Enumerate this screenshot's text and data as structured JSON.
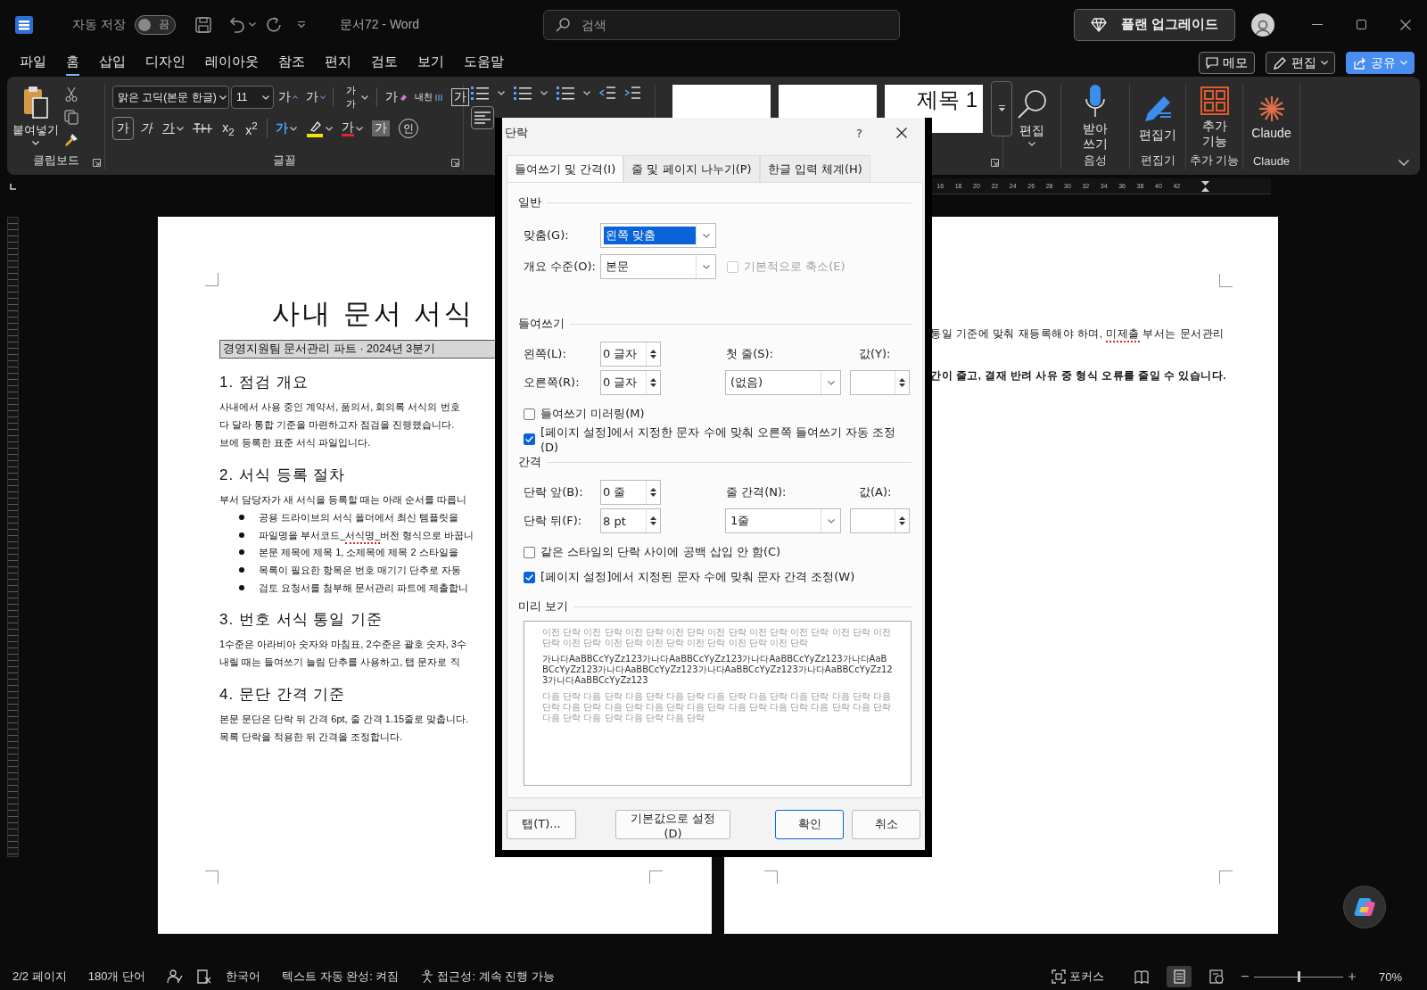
{
  "titlebar": {
    "autosave_label": "자동 저장",
    "autosave_toggle": {
      "label": "끔",
      "on": false
    },
    "document_title": "문서72  -  Word",
    "search": {
      "placeholder": "검색"
    },
    "upgrade_button": "플랜 업그레이드"
  },
  "menu": {
    "tabs": [
      {
        "label": "파일",
        "selected": false
      },
      {
        "label": "홈",
        "selected": true
      },
      {
        "label": "삽입",
        "selected": false
      },
      {
        "label": "디자인",
        "selected": false
      },
      {
        "label": "레이아웃",
        "selected": false
      },
      {
        "label": "참조",
        "selected": false
      },
      {
        "label": "편지",
        "selected": false
      },
      {
        "label": "검토",
        "selected": false
      },
      {
        "label": "보기",
        "selected": false
      },
      {
        "label": "도움말",
        "selected": false
      }
    ],
    "buttons": [
      {
        "kind": "comment",
        "label": "메모"
      },
      {
        "kind": "edit",
        "label": "편집"
      },
      {
        "kind": "share",
        "label": "공유"
      }
    ]
  },
  "ribbon": {
    "clipboard": {
      "paste": "붙여넣기",
      "label": "클립보드"
    },
    "font": {
      "typeface": "맑은 고딕(본문 한글)",
      "size": "11",
      "label": "글꼴",
      "row1": [
        {
          "kind": "grow",
          "text": "가",
          "menu": false
        },
        {
          "kind": "shrink",
          "text": "가",
          "menu": false
        },
        {
          "kind": "case",
          "text": "가가",
          "menu": true
        },
        {
          "kind": "clear",
          "text": "가",
          "menu": false
        },
        {
          "kind": "phonetic",
          "text": "내천",
          "menu": false
        },
        {
          "kind": "border",
          "text": "가",
          "menu": false
        }
      ],
      "row2": [
        {
          "kind": "bold",
          "text": "가",
          "pressed": true,
          "menu": false
        },
        {
          "kind": "italic",
          "text": "가",
          "pressed": false,
          "menu": false
        },
        {
          "kind": "underline",
          "text": "가",
          "pressed": false,
          "menu": true
        },
        {
          "kind": "strike",
          "pressed": false,
          "menu": false
        },
        {
          "kind": "subscript",
          "text": "x$_{2}$",
          "pressed": false,
          "menu": false
        },
        {
          "kind": "superscript",
          "text": "x$^{2}$",
          "pressed": false,
          "menu": false
        },
        {
          "kind": "effects",
          "text": "가",
          "pressed": false,
          "menu": true
        },
        {
          "kind": "highlight",
          "pressed": false,
          "menu": true
        },
        {
          "kind": "color",
          "text": "가",
          "pressed": false,
          "menu": true
        },
        {
          "kind": "shading",
          "text": "가",
          "pressed": false,
          "menu": false
        },
        {
          "kind": "enclose",
          "text": "인",
          "pressed": false,
          "menu": false
        }
      ]
    },
    "styles": {
      "items": [
        {
          "label": "제목 1"
        }
      ]
    },
    "groups": [
      {
        "kind": "search",
        "button": "편집"
      },
      {
        "kind": "mic",
        "button": "받아\n쓰기",
        "label": "음성"
      },
      {
        "kind": "editor",
        "button": "편집기",
        "label": "편집기"
      },
      {
        "kind": "addins",
        "button": "추가\n기능",
        "label": "추가 기능"
      },
      {
        "kind": "claude",
        "button": "Claude",
        "label": "Claude"
      }
    ]
  },
  "ruler_numbers": [
    "16",
    "18",
    "20",
    "22",
    "24",
    "26",
    "28",
    "30",
    "32",
    "34",
    "36",
    "38",
    "40",
    "42"
  ],
  "left_page": {
    "title": "사내 문서 서식",
    "subtitle": "경영지원팀 문서관리 파트 · 2024년 3분기",
    "sections": [
      {
        "heading": "1. 점검 개요",
        "lines": [
          "사내에서 사용 중인 계약서, 품의서, 회의록 서식의 번호",
          "다 달라 통합 기준을 마련하고자 점검을 진행했습니다.",
          "브에 등록한 표준 서식 파일입니다."
        ]
      },
      {
        "heading": "2. 서식 등록 절차",
        "lines": [
          "부서 담당자가 새 서식을 등록할 때는 아래 순서를 따릅니"
        ],
        "bullets": [
          "공용 드라이브의 서식 폴더에서 최신 템플릿을",
          {
            "parts": [
              {
                "text": "파일명을 부서코드_",
                "misspelled": false
              },
              {
                "text": "서식명_",
                "misspelled": true
              },
              {
                "text": "버전 형식으로 바꿉니",
                "misspelled": false
              }
            ]
          },
          "본문 제목에 제목 1, 소제목에 제목 2 스타일을",
          "목록이 필요한 항목은 번호 매기기 단추로 자동",
          "검토 요청서를 첨부해 문서관리 파트에 제출합니"
        ]
      },
      {
        "heading": "3. 번호 서식 통일 기준",
        "lines": [
          "1수준은 아라비아 숫자와 마침표, 2수준은 괄호 숫자, 3수",
          "내릴 때는 들여쓰기 늘림 단추를 사용하고, 탭 문자로 직"
        ]
      },
      {
        "heading": "4. 문단 간격 기준",
        "lines": [
          "본문 문단은 단락 뒤 간격 6pt, 줄 간격 1.15줄로 맞춥니다.",
          "목록 단락을 적용한 뒤 간격을 조정합니다."
        ]
      }
    ]
  },
  "right_page": {
    "lines": [
      {
        "bold": false,
        "parts": [
          {
            "text": "통일 기준에 맞춰 재등록해야 하며, ",
            "misspelled": false
          },
          {
            "text": "미제출",
            "misspelled": true
          },
          {
            "text": " 부서는 문서관리",
            "misspelled": false
          }
        ]
      },
      {
        "bold": true,
        "parts": [
          {
            "text": "간이 줄고, 결재 반려 사유 중 형식 오류를 줄일 수 있습니다.",
            "misspelled": false
          }
        ]
      }
    ]
  },
  "dialog": {
    "title": "단락",
    "help": "?",
    "tabs": [
      {
        "label": "들여쓰기 및 간격(I)",
        "selected": true
      },
      {
        "label": "줄 및 페이지 나누기(P)",
        "selected": false
      },
      {
        "label": "한글 입력 체계(H)",
        "selected": false
      }
    ],
    "general": {
      "heading": "일반",
      "alignment": {
        "label": "맞춤(G):",
        "value": "왼쪽 맞춤",
        "focused": true
      },
      "outline": {
        "label": "개요 수준(O):",
        "value": "본문",
        "focused": false
      },
      "collapse": {
        "label": "기본적으로 축소(E)",
        "checked": false,
        "disabled": true
      }
    },
    "indent": {
      "heading": "들여쓰기",
      "left": {
        "label": "왼쪽(L):",
        "value": "0 글자"
      },
      "right": {
        "label": "오른쪽(R):",
        "value": "0 글자"
      },
      "special": {
        "label": "첫 줄(S):",
        "value": "(없음)"
      },
      "by": {
        "label": "값(Y):"
      },
      "options": [
        {
          "label": "들여쓰기 미러링(M)",
          "checked": false
        },
        {
          "label": "[페이지 설정]에서 지정한 문자 수에 맞춰 오른쪽 들여쓰기 자동 조정(D)",
          "checked": true
        }
      ]
    },
    "spacing": {
      "heading": "간격",
      "before": {
        "label": "단락 앞(B):",
        "value": "0 줄"
      },
      "after": {
        "label": "단락 뒤(F):",
        "value": "8 pt"
      },
      "line": {
        "label": "줄 간격(N):",
        "value": "1줄"
      },
      "at": {
        "label": "값(A):"
      },
      "options": [
        {
          "label": "같은 스타일의 단락 사이에 공백 삽입 안 함(C)",
          "checked": false
        },
        {
          "label": "[페이지 설정]에서 지정된 문자 수에 맞춰 문자 간격 조정(W)",
          "checked": true
        }
      ]
    },
    "preview": {
      "heading": "미리 보기",
      "previous": "이전 단락 이전 단락 이전 단락 이전 단락 이전 단락 이전 단락 이전 단락 이전 단락 이전 단락 이전 단락 이전 단락 이전 단락 이전 단락 이전 단락 이전 단락",
      "sample": "가나다AaBBCcYyZz123가나다AaBBCcYyZz123가나다AaBBCcYyZz123가나다AaBBCcYyZz123가나다AaBBCcYyZz123가나다AaBBCcYyZz123가나다AaBBCcYyZz123가나다AaBBCcYyZz123",
      "next": "다음 단락 다음 단락 다음 단락 다음 단락 다음 단락 다음 단락 다음 단락 다음 단락 다음 단락 다음 단락 다음 단락 다음 단락 다음 단락 다음 단락 다음 단락 다음 단락 다음 단락 다음 단락 다음 단락 다음 단락 다음 단락"
    },
    "buttons": [
      {
        "label": "탭(T)...",
        "default": false
      },
      {
        "label": "기본값으로 설정(D)",
        "default": false
      },
      {
        "label": "확인",
        "default": true
      },
      {
        "label": "취소",
        "default": false
      }
    ]
  },
  "status": {
    "page": "2/2 페이지",
    "words": "180개 단어",
    "language": "한국어",
    "autocomplete": "텍스트 자동 완성: 켜짐",
    "accessibility": "접근성: 계속 진행 가능",
    "focus": "포커스",
    "views": [
      {
        "kind": "read",
        "selected": false
      },
      {
        "kind": "print",
        "selected": true
      },
      {
        "kind": "web",
        "selected": false
      }
    ],
    "zoom": {
      "label": "70%",
      "level": 0.5
    }
  }
}
